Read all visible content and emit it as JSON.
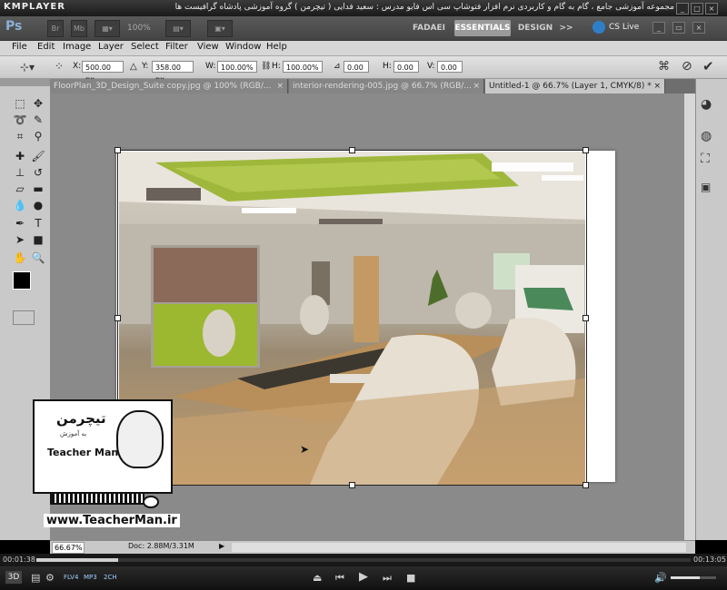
{
  "player": {
    "logo": "KMPLAYER",
    "title": "مجموعه آموزشی جامع ، گام به گام و کاربردی نرم افزار فتوشاپ سی اس فایو مدرس : سعید فدایی ( تیچرمن ) گروه آموزشی پادشاه گرافیست ها",
    "time_elapsed": "00:01:38",
    "time_total": "00:13:05",
    "badges": [
      "FLV4",
      "MP3",
      "2CH"
    ],
    "mode_3d": "3D"
  },
  "ps": {
    "logo": "Ps",
    "zoom_value": "100%",
    "workspaces": [
      "FADAEI",
      "ESSENTIALS",
      "DESIGN"
    ],
    "more": ">>",
    "cslive": "CS Live",
    "menus": [
      "File",
      "Edit",
      "Image",
      "Layer",
      "Select",
      "Filter",
      "View",
      "Window",
      "Help"
    ],
    "options": {
      "x_label": "X:",
      "x": "500.00 px",
      "y_label": "Y:",
      "y": "358.00 px",
      "w_label": "W:",
      "w": "100.00%",
      "h_label": "H:",
      "h": "100.00%",
      "angle": "0.00",
      "hskew_label": "H:",
      "hskew": "0.00",
      "vskew_label": "V:",
      "vskew": "0.00"
    },
    "tabs": [
      {
        "label": "FloorPlan_3D_Design_Suite copy.jpg @ 100% (RGB/...",
        "close": "×"
      },
      {
        "label": "interior-rendering-005.jpg @ 66.7% (RGB/...",
        "close": "×"
      },
      {
        "label": "Untitled-1 @ 66.7% (Layer 1, CMYK/8) *",
        "close": "×"
      }
    ],
    "status": {
      "zoom": "66.67%",
      "doc": "Doc: 2.88M/3.31M"
    }
  },
  "watermark": {
    "brand_fa": "تیچرمن",
    "tagline_fa": "به آموزش",
    "brand_en": "Teacher Man",
    "url": "www.TeacherMan.ir"
  },
  "colors": {
    "accent": "#9a9a9a",
    "foreground_swatch": "#000000",
    "background_swatch": "#ffffff"
  }
}
